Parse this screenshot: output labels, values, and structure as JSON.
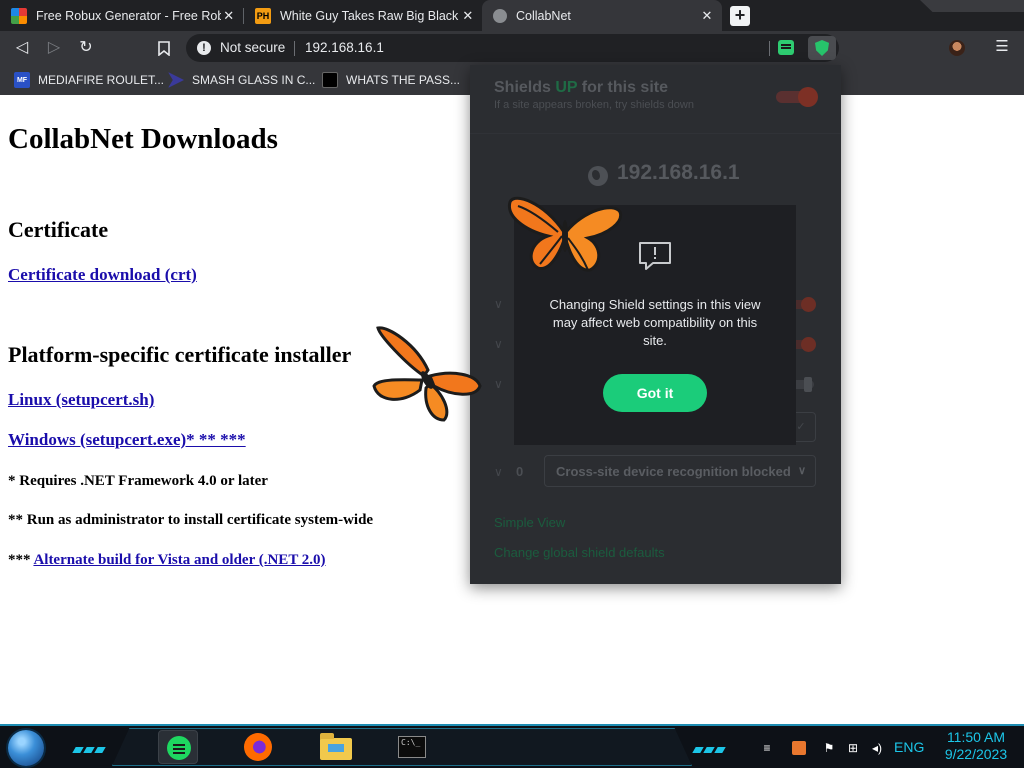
{
  "browser": {
    "tabs": [
      {
        "title": "Free Robux Generator - Free Robux",
        "favicon": "rainbow-icon",
        "active": false
      },
      {
        "title": "White Guy Takes Raw Big Black Co",
        "favicon": "ph-icon",
        "favicon_text": "PH",
        "active": false
      },
      {
        "title": "CollabNet",
        "favicon": "globe-icon",
        "active": true
      }
    ],
    "close_glyph": "✕",
    "new_tab_glyph": "+",
    "address": {
      "security_label": "Not secure",
      "url": "192.168.16.1"
    },
    "bookmarks": [
      {
        "label": "MEDIAFIRE ROULET...",
        "icon": "mediafire-icon",
        "icon_text": "MF"
      },
      {
        "label": "SMASH GLASS IN C...",
        "icon": "bracket-icon"
      },
      {
        "label": "WHATS THE PASS...",
        "icon": "tool-icon"
      }
    ]
  },
  "page": {
    "title": "CollabNet Downloads",
    "section_certificate": "Certificate",
    "cert_link": "Certificate download (crt)",
    "section_platform": "Platform-specific certificate installer",
    "linux_link": "Linux (setupcert.sh)",
    "windows_link": "Windows (setupcert.exe)* ** ***",
    "note1": "* Requires .NET Framework 4.0 or later",
    "note2": "** Run as administrator to install certificate system-wide",
    "note3_prefix": "***",
    "note3_link": "Alternate build for Vista and older (.NET 2.0)"
  },
  "shields": {
    "title_prefix": "Shields",
    "title_up": "UP",
    "title_suffix": "for this site",
    "subtitle": "If a site appears broken, try shields down",
    "site": "192.168.16.1",
    "device_count": "0",
    "device_option": "Cross-site device recognition blocked",
    "simple_view": "Simple View",
    "global_defaults": "Change global shield defaults",
    "colors": {
      "up": "#1f6b45",
      "accent": "#1bcc7a"
    }
  },
  "modal": {
    "icon": "warning-speech-bubble-icon",
    "message": "Changing Shield settings in this view may affect web compatibility on this site.",
    "button": "Got it"
  },
  "taskbar": {
    "apps": [
      "notes-icon",
      "firefox-icon",
      "file-explorer-icon",
      "command-prompt-icon"
    ],
    "cmd_text": "C:\\_",
    "language": "ENG",
    "time": "11:50 AM",
    "date": "9/22/2023"
  }
}
